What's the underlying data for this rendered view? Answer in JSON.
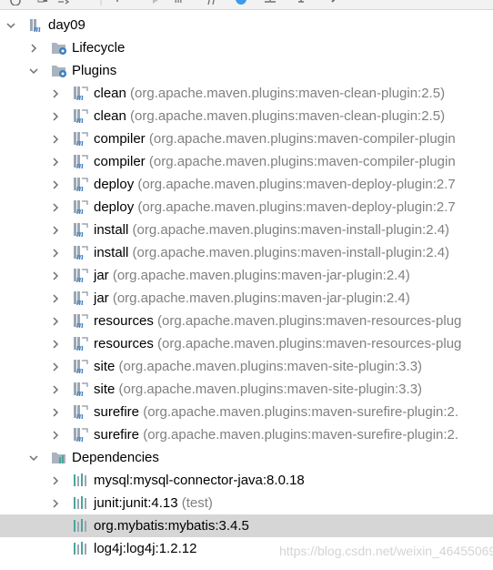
{
  "toolbar": {
    "icons": [
      "refresh-icon",
      "generate-sources-icon",
      "download-icon",
      "add-icon",
      "run-icon",
      "execute-goal-icon",
      "toggle-offline-icon",
      "show-dependencies-icon",
      "collapse-icon",
      "expand-icon",
      "settings-icon"
    ]
  },
  "tree": {
    "root": {
      "label": "day09"
    },
    "lifecycle": {
      "label": "Lifecycle"
    },
    "plugins": {
      "label": "Plugins",
      "items": [
        {
          "name": "clean",
          "detail": "(org.apache.maven.plugins:maven-clean-plugin:2.5)"
        },
        {
          "name": "clean",
          "detail": "(org.apache.maven.plugins:maven-clean-plugin:2.5)"
        },
        {
          "name": "compiler",
          "detail": "(org.apache.maven.plugins:maven-compiler-plugin"
        },
        {
          "name": "compiler",
          "detail": "(org.apache.maven.plugins:maven-compiler-plugin"
        },
        {
          "name": "deploy",
          "detail": "(org.apache.maven.plugins:maven-deploy-plugin:2.7"
        },
        {
          "name": "deploy",
          "detail": "(org.apache.maven.plugins:maven-deploy-plugin:2.7"
        },
        {
          "name": "install",
          "detail": "(org.apache.maven.plugins:maven-install-plugin:2.4)"
        },
        {
          "name": "install",
          "detail": "(org.apache.maven.plugins:maven-install-plugin:2.4)"
        },
        {
          "name": "jar",
          "detail": "(org.apache.maven.plugins:maven-jar-plugin:2.4)"
        },
        {
          "name": "jar",
          "detail": "(org.apache.maven.plugins:maven-jar-plugin:2.4)"
        },
        {
          "name": "resources",
          "detail": "(org.apache.maven.plugins:maven-resources-plug"
        },
        {
          "name": "resources",
          "detail": "(org.apache.maven.plugins:maven-resources-plug"
        },
        {
          "name": "site",
          "detail": "(org.apache.maven.plugins:maven-site-plugin:3.3)"
        },
        {
          "name": "site",
          "detail": "(org.apache.maven.plugins:maven-site-plugin:3.3)"
        },
        {
          "name": "surefire",
          "detail": "(org.apache.maven.plugins:maven-surefire-plugin:2."
        },
        {
          "name": "surefire",
          "detail": "(org.apache.maven.plugins:maven-surefire-plugin:2."
        }
      ]
    },
    "dependencies": {
      "label": "Dependencies",
      "items": [
        {
          "name": "mysql:mysql-connector-java:8.0.18",
          "detail": "",
          "expandable": true,
          "selected": false
        },
        {
          "name": "junit:junit:4.13",
          "detail": "(test)",
          "expandable": true,
          "selected": false
        },
        {
          "name": "org.mybatis:mybatis:3.4.5",
          "detail": "",
          "expandable": false,
          "selected": true
        },
        {
          "name": "log4j:log4j:1.2.12",
          "detail": "",
          "expandable": false,
          "selected": false
        }
      ]
    }
  },
  "watermark": "https://blog.csdn.net/weixin_46455069",
  "colors": {
    "selection": "#d6d6d6",
    "detail_text": "#808080",
    "maven_blue": "#3d7fc4",
    "library_teal": "#4aa59a"
  }
}
